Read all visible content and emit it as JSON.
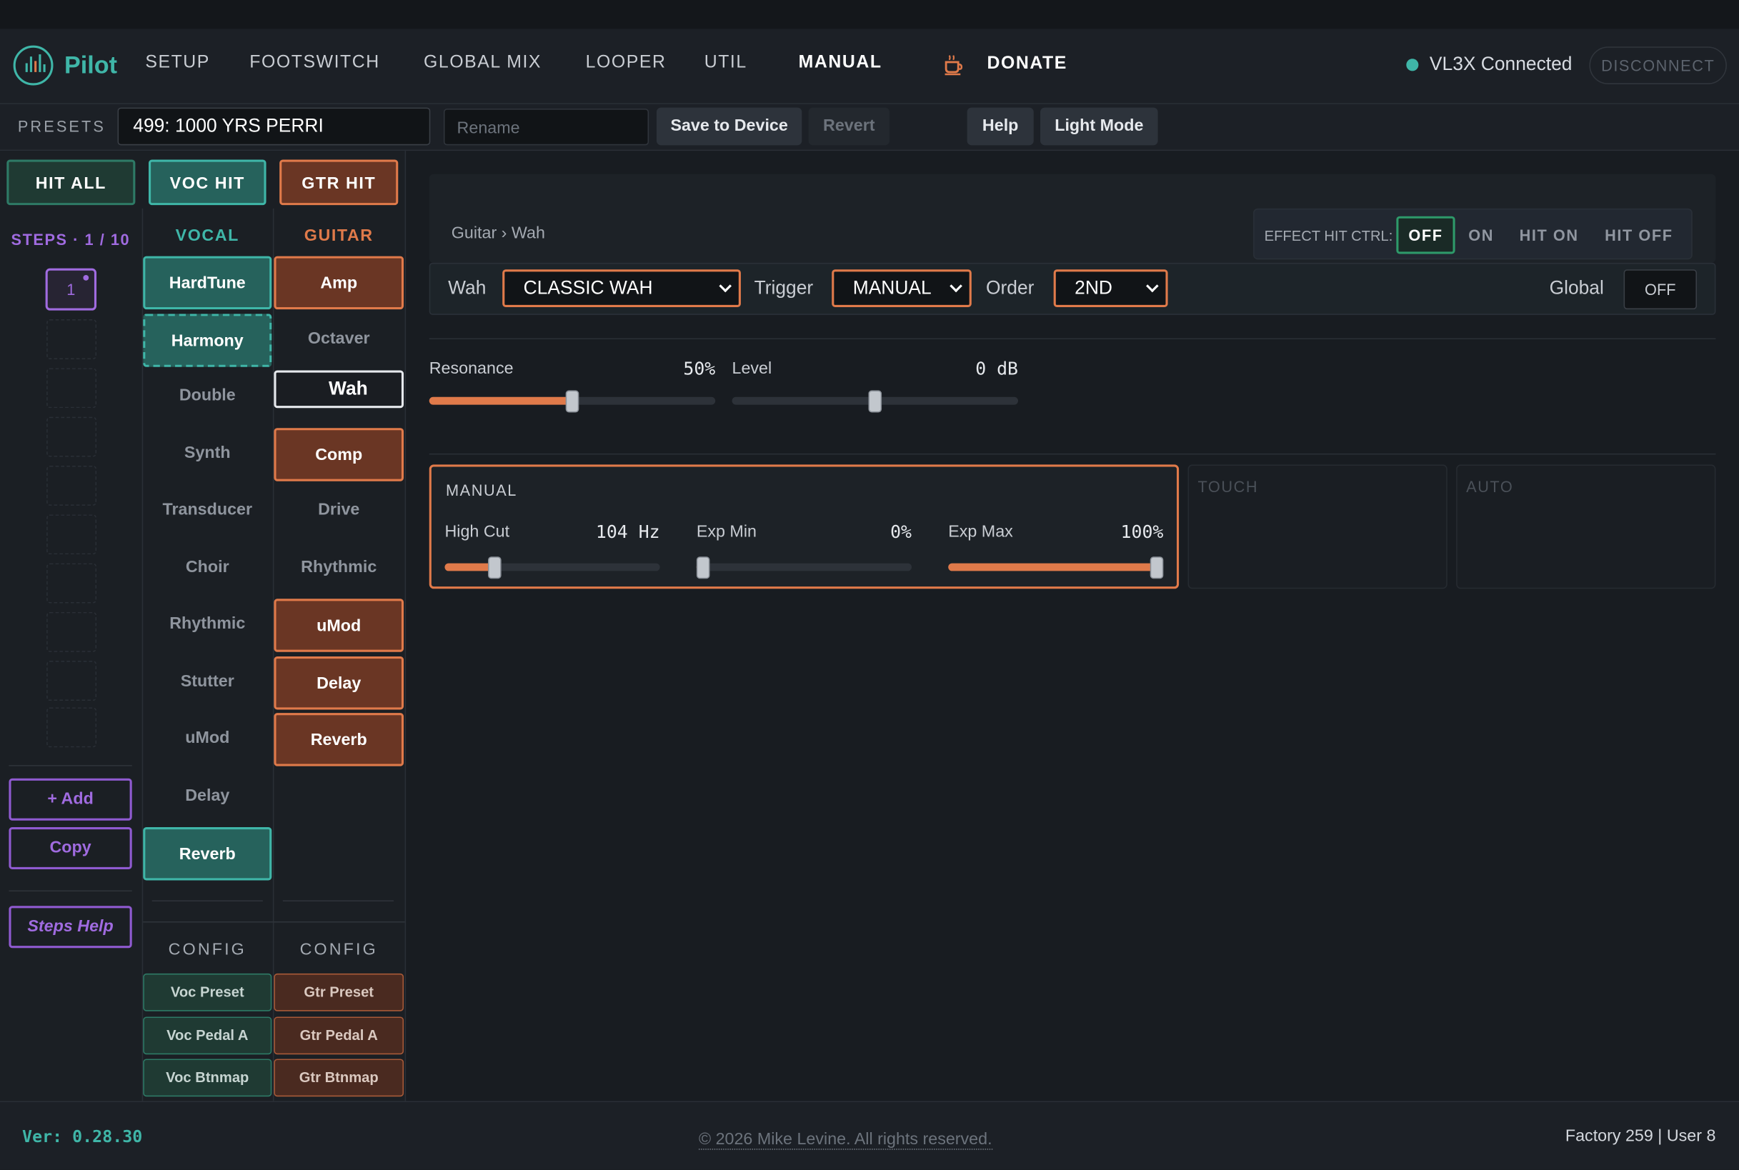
{
  "app": {
    "brand": "Pilot",
    "version": "Ver: 0.28.30",
    "copyright": "© 2026 Mike Levine. All rights reserved.",
    "counts": "Factory 259 | User 8"
  },
  "nav": {
    "setup": "SETUP",
    "footswitch": "FOOTSWITCH",
    "global_mix": "GLOBAL MIX",
    "looper": "LOOPER",
    "util": "UTIL",
    "manual": "MANUAL",
    "donate": "DONATE"
  },
  "connection": {
    "status": "VL3X Connected",
    "disconnect": "DISCONNECT",
    "color": "#3fb6a8"
  },
  "presets": {
    "label": "PRESETS",
    "current": "499: 1000 YRS PERRI",
    "rename_placeholder": "Rename",
    "save": "Save to Device",
    "revert": "Revert",
    "help": "Help",
    "light_mode": "Light Mode"
  },
  "hits": {
    "hit_all": "HIT ALL",
    "voc_hit": "VOC HIT",
    "gtr_hit": "GTR HIT"
  },
  "steps": {
    "label": "STEPS · 1 / 10",
    "current": "1",
    "add": "+ Add",
    "copy": "Copy",
    "help": "Steps Help"
  },
  "vocal": {
    "header": "VOCAL",
    "items": [
      {
        "label": "HardTune",
        "state": "on"
      },
      {
        "label": "Harmony",
        "state": "dashed"
      },
      {
        "label": "Double",
        "state": "off"
      },
      {
        "label": "Synth",
        "state": "off"
      },
      {
        "label": "Transducer",
        "state": "off"
      },
      {
        "label": "Choir",
        "state": "off"
      },
      {
        "label": "Rhythmic",
        "state": "off"
      },
      {
        "label": "Stutter",
        "state": "off"
      },
      {
        "label": "uMod",
        "state": "off"
      },
      {
        "label": "Delay",
        "state": "off"
      },
      {
        "label": "Reverb",
        "state": "on"
      }
    ],
    "config_header": "CONFIG",
    "config": [
      "Voc Preset",
      "Voc Pedal A",
      "Voc Btnmap"
    ]
  },
  "guitar": {
    "header": "GUITAR",
    "items": [
      {
        "label": "Amp",
        "state": "on"
      },
      {
        "label": "Octaver",
        "state": "off"
      },
      {
        "label": "Wah",
        "state": "selected"
      },
      {
        "label": "Comp",
        "state": "on"
      },
      {
        "label": "Drive",
        "state": "off"
      },
      {
        "label": "Rhythmic",
        "state": "off"
      },
      {
        "label": "uMod",
        "state": "on"
      },
      {
        "label": "Delay",
        "state": "on"
      },
      {
        "label": "Reverb",
        "state": "on"
      }
    ],
    "config_header": "CONFIG",
    "config": [
      "Gtr Preset",
      "Gtr Pedal A",
      "Gtr Btnmap"
    ]
  },
  "effect": {
    "breadcrumb": "Guitar › Wah",
    "hit_ctrl": {
      "label": "EFFECT HIT CTRL:",
      "options": [
        "OFF",
        "ON",
        "HIT ON",
        "HIT OFF"
      ],
      "selected": "OFF"
    },
    "wah_label": "Wah",
    "wah_value": "CLASSIC WAH",
    "trigger_label": "Trigger",
    "trigger_value": "MANUAL",
    "order_label": "Order",
    "order_value": "2ND",
    "global_label": "Global",
    "global_value": "OFF",
    "resonance": {
      "label": "Resonance",
      "display": "50%",
      "level": 0.5
    },
    "level": {
      "label": "Level",
      "display": "0 dB",
      "level": 0.5
    },
    "manual_panel": {
      "title": "MANUAL",
      "high_cut": {
        "label": "High Cut",
        "display": "104 Hz",
        "level": 0.23
      },
      "exp_min": {
        "label": "Exp Min",
        "display": "0%",
        "level": 0.0
      },
      "exp_max": {
        "label": "Exp Max",
        "display": "100%",
        "level": 1.0
      }
    },
    "touch_title": "TOUCH",
    "auto_title": "AUTO"
  },
  "colors": {
    "accent_vocal": "#3fb6a8",
    "accent_guitar": "#e07a4a",
    "accent_steps": "#a06be0"
  }
}
